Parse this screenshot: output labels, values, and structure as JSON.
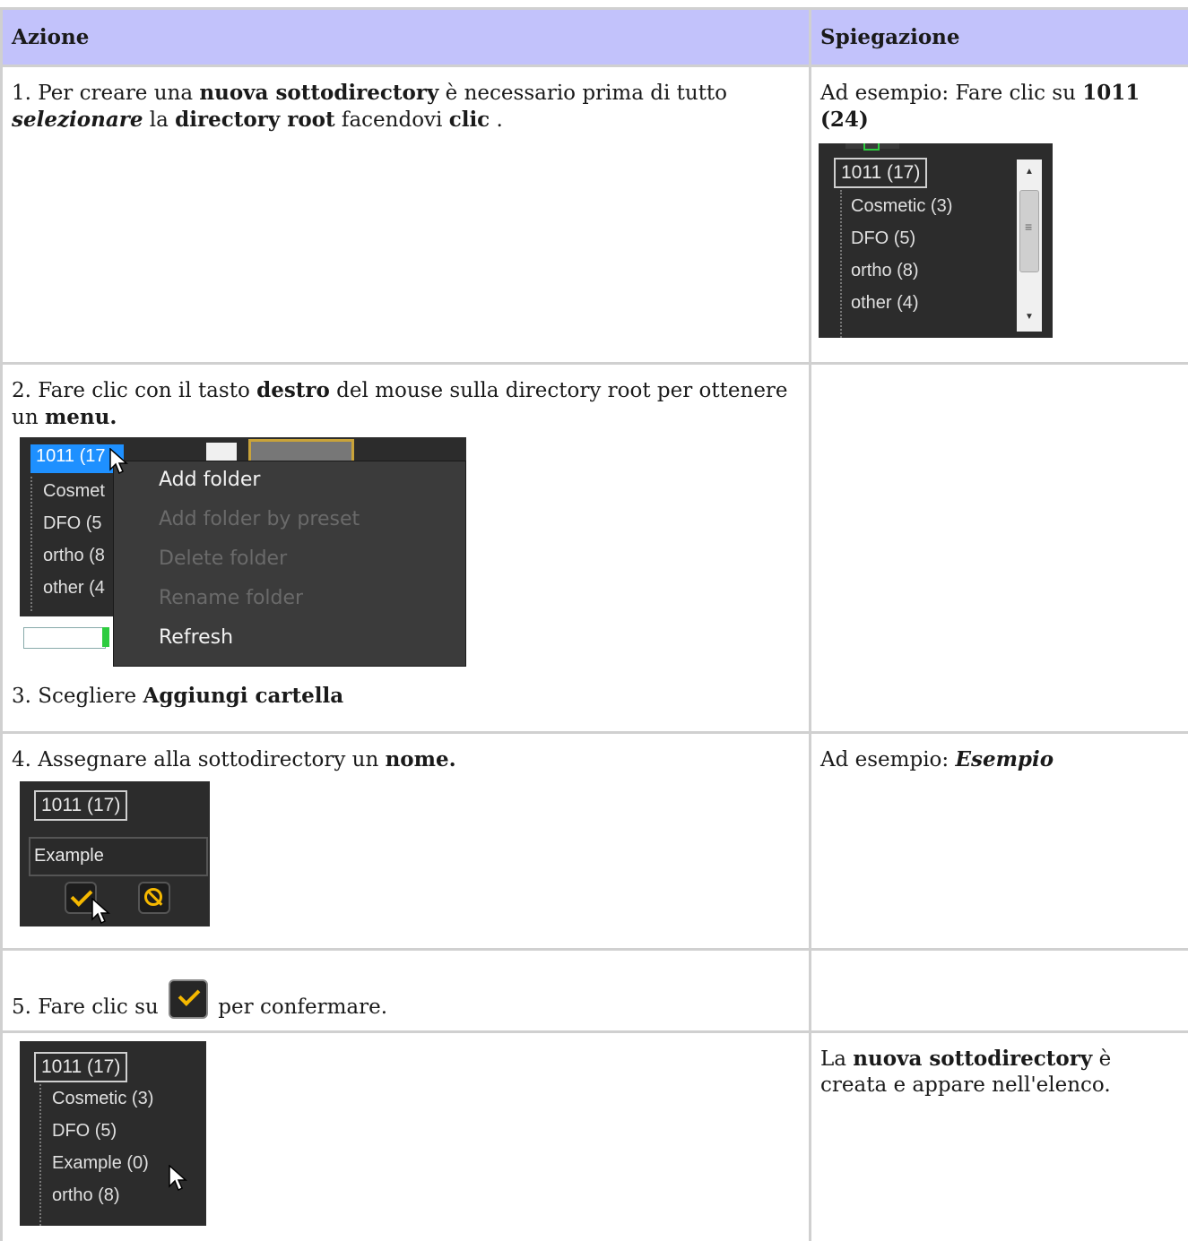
{
  "header": {
    "col1": "Azione",
    "col2": "Spiegazione"
  },
  "row1": {
    "p1": "1. Per creare una ",
    "b1": "nuova sottodirectory",
    "p2": " è necessario prima di tutto ",
    "bi1": "selezionare",
    "p3": " la ",
    "b2": "directory root",
    "p4": " facendovi ",
    "b3": "clic",
    "p5": " .",
    "expl1": "Ad esempio: Fare clic su ",
    "expl_b": "1011 (24)",
    "tree": {
      "root": "1011 (17)",
      "items": [
        "Cosmetic (3)",
        "DFO (5)",
        "ortho (8)",
        "other (4)"
      ],
      "scroll_lines": "≡"
    }
  },
  "row2": {
    "p1": "2. Fare clic con il tasto ",
    "b1": "destro",
    "p2": " del mouse sulla directory root per ottenere un ",
    "b2": "menu.",
    "tree": {
      "root": "1011 (17",
      "items": [
        "Cosmet",
        "DFO (5",
        "ortho (8",
        "other (4"
      ]
    },
    "menu": [
      "Add folder",
      "Add folder by preset",
      "Delete folder",
      "Rename folder",
      "Refresh"
    ],
    "menu_enabled": [
      true,
      false,
      false,
      false,
      true
    ],
    "p3": "3. Scegliere ",
    "b3": "Aggiungi cartella"
  },
  "row3": {
    "p1": "4. Assegnare alla sottodirectory un ",
    "b1": "nome.",
    "expl1": "Ad esempio: ",
    "expl_bi": "Esempio",
    "tree": {
      "root": "1011 (17)",
      "input": "Example"
    }
  },
  "row4": {
    "p1": "5. Fare clic su ",
    "p2": " per confermare."
  },
  "row5": {
    "tree": {
      "root": "1011 (17)",
      "items": [
        "Cosmetic (3)",
        "DFO (5)",
        "Example (0)",
        "ortho (8)"
      ]
    },
    "expl1": "La ",
    "expl_b": "nuova sottodirectory",
    "expl2": " è creata e appare nell'elenco."
  },
  "colors": {
    "header_bg": "#c2c2fb",
    "border": "#d0d0d0",
    "accent_yellow": "#f5b800",
    "selected_blue": "#1e90ff"
  }
}
